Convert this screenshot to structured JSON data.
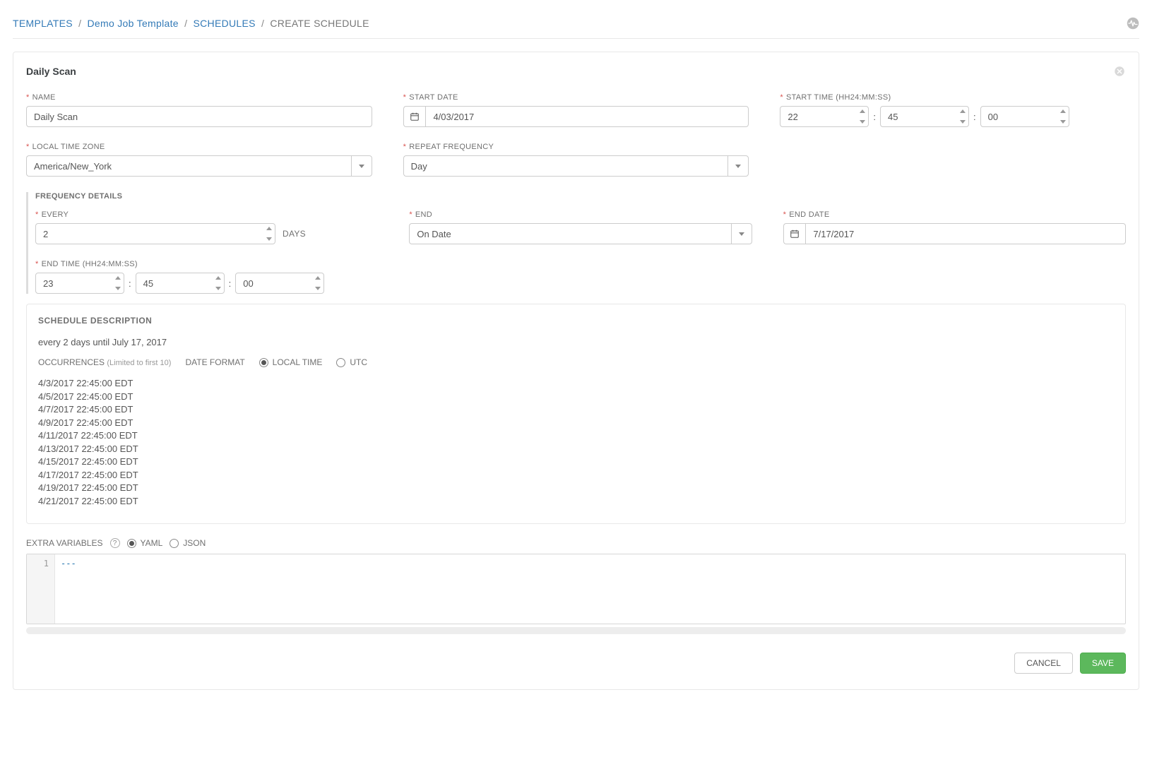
{
  "breadcrumb": {
    "templates": "TEMPLATES",
    "job_template": "Demo Job Template",
    "schedules": "SCHEDULES",
    "create": "CREATE SCHEDULE"
  },
  "page_title": "Daily Scan",
  "fields": {
    "name_label": "NAME",
    "name_value": "Daily Scan",
    "start_date_label": "START DATE",
    "start_date_value": "4/03/2017",
    "start_time_label": "START TIME (HH24:MM:SS)",
    "start_time_hh": "22",
    "start_time_mm": "45",
    "start_time_ss": "00",
    "tz_label": "LOCAL TIME ZONE",
    "tz_value": "America/New_York",
    "repeat_label": "REPEAT FREQUENCY",
    "repeat_value": "Day"
  },
  "freq": {
    "section_title": "FREQUENCY DETAILS",
    "every_label": "EVERY",
    "every_value": "2",
    "every_unit": "DAYS",
    "end_label": "END",
    "end_value": "On Date",
    "end_date_label": "END DATE",
    "end_date_value": "7/17/2017",
    "end_time_label": "END TIME (HH24:MM:SS)",
    "end_time_hh": "23",
    "end_time_mm": "45",
    "end_time_ss": "00"
  },
  "description": {
    "title": "SCHEDULE DESCRIPTION",
    "summary": "every 2 days until July 17, 2017",
    "occurrences_label": "OCCURRENCES",
    "occurrences_note": "(Limited to first 10)",
    "date_format_label": "DATE FORMAT",
    "local_label": "LOCAL TIME",
    "utc_label": "UTC",
    "occurrences": [
      "4/3/2017 22:45:00 EDT",
      "4/5/2017 22:45:00 EDT",
      "4/7/2017 22:45:00 EDT",
      "4/9/2017 22:45:00 EDT",
      "4/11/2017 22:45:00 EDT",
      "4/13/2017 22:45:00 EDT",
      "4/15/2017 22:45:00 EDT",
      "4/17/2017 22:45:00 EDT",
      "4/19/2017 22:45:00 EDT",
      "4/21/2017 22:45:00 EDT"
    ]
  },
  "extra_vars": {
    "label": "EXTRA VARIABLES",
    "yaml_label": "YAML",
    "json_label": "JSON",
    "line_no": "1",
    "content": "---"
  },
  "buttons": {
    "cancel": "CANCEL",
    "save": "SAVE"
  }
}
